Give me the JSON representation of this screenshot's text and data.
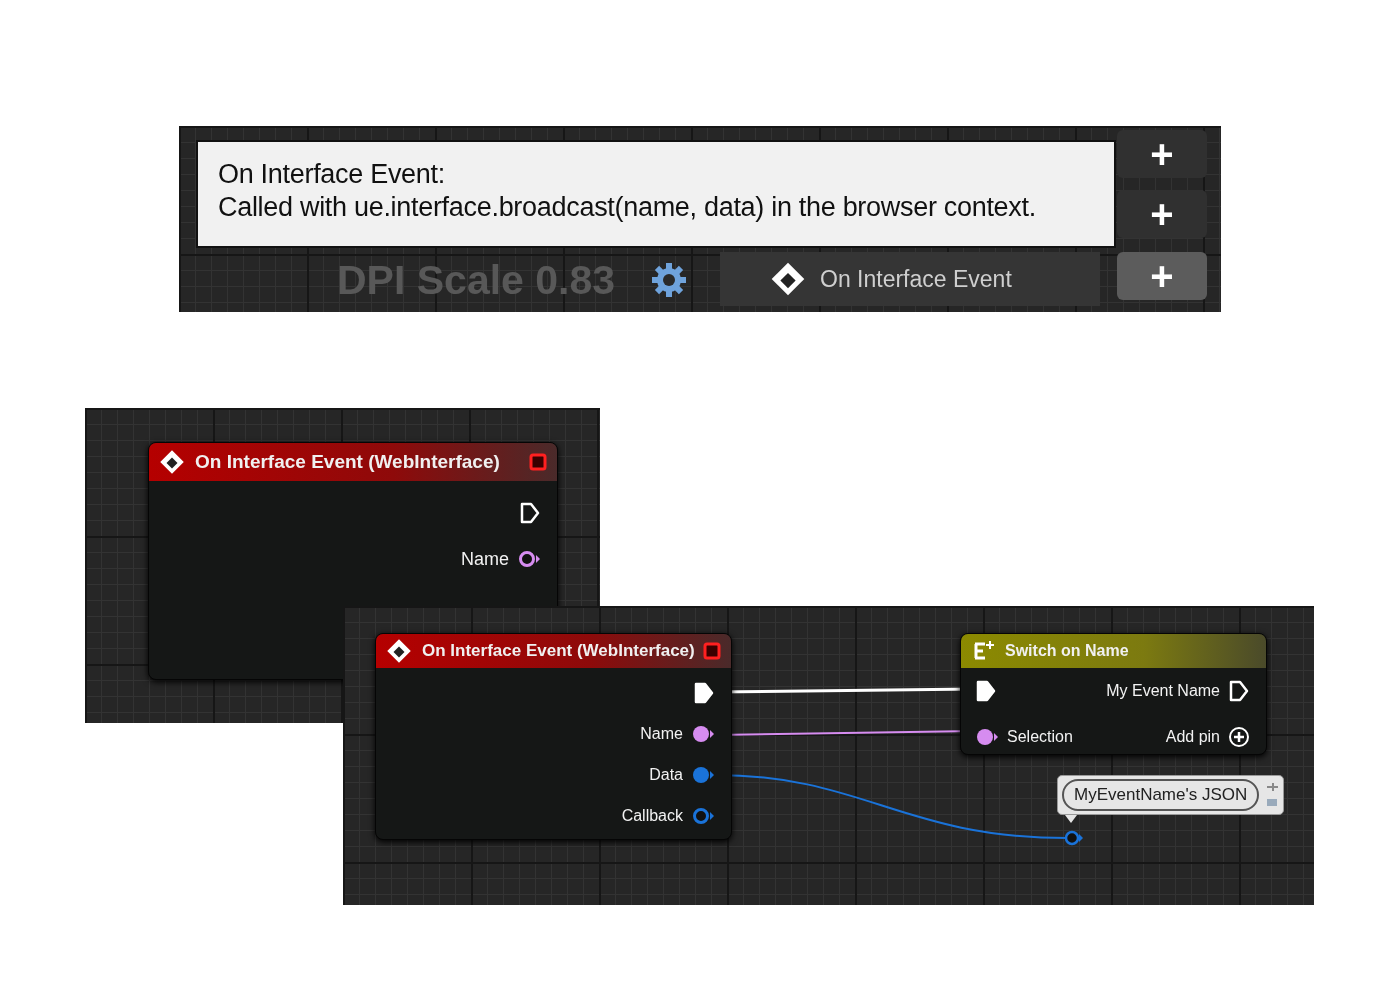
{
  "tooltip_panel": {
    "tooltip": {
      "title": "On Interface Event:",
      "description": "Called with ue.interface.broadcast(name, data) in the browser context."
    },
    "dpi_scale": "DPI Scale 0.83",
    "event_item": {
      "label": "On Interface Event"
    },
    "add_buttons": [
      {
        "label": "+",
        "highlighted": false
      },
      {
        "label": "+",
        "highlighted": false
      },
      {
        "label": "+",
        "highlighted": true
      }
    ]
  },
  "graph_views": [
    {
      "nodes": [
        {
          "kind": "event",
          "title": "On Interface Event (WebInterface)",
          "outputs": [
            {
              "kind": "exec",
              "connected": false
            },
            {
              "kind": "data",
              "label": "Name",
              "color": "#d68cf0",
              "connected": false
            }
          ]
        }
      ]
    },
    {
      "nodes": [
        {
          "kind": "event",
          "title": "On Interface Event (WebInterface)",
          "outputs": [
            {
              "kind": "exec",
              "connected": true
            },
            {
              "kind": "data",
              "label": "Name",
              "color": "#d68cf0",
              "connected": true
            },
            {
              "kind": "data",
              "label": "Data",
              "color": "#1a73d9",
              "connected": true
            },
            {
              "kind": "data",
              "label": "Callback",
              "color": "#1a73d9",
              "connected": false
            }
          ]
        },
        {
          "kind": "switch",
          "title": "Switch on Name",
          "inputs": [
            {
              "kind": "exec",
              "connected": true
            },
            {
              "kind": "data",
              "label": "Selection",
              "color": "#d68cf0",
              "connected": true
            }
          ],
          "outputs": [
            {
              "kind": "exec",
              "label": "My Event Name",
              "connected": false
            },
            {
              "kind": "add",
              "label": "Add pin"
            }
          ]
        }
      ],
      "comment": {
        "text": "MyEventName's JSON"
      }
    }
  ]
}
